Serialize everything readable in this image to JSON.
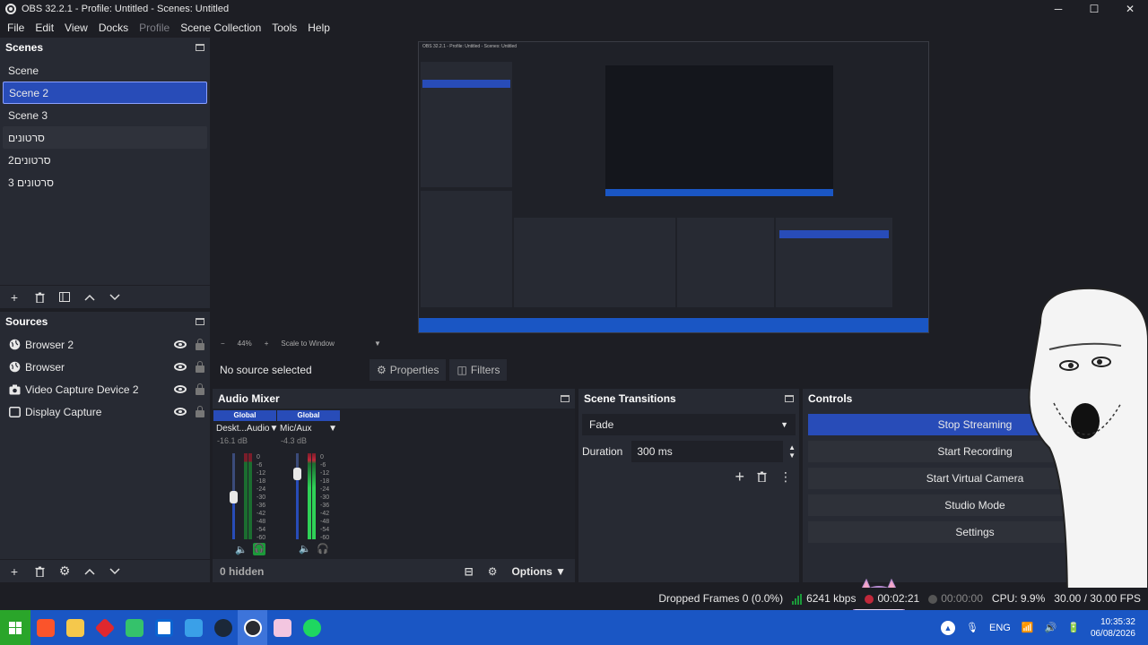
{
  "window": {
    "title": "OBS 32.2.1 - Profile: Untitled - Scenes: Untitled",
    "min": "─",
    "max": "☐",
    "close": "✕"
  },
  "menu": [
    "File",
    "Edit",
    "View",
    "Docks",
    "Profile",
    "Scene Collection",
    "Tools",
    "Help"
  ],
  "scenes": {
    "title": "Scenes",
    "items": [
      "Scene",
      "Scene 2",
      "Scene 3",
      "סרטונים",
      "סרטונים2",
      "סרטונים 3"
    ],
    "selected": "Scene 2"
  },
  "sources": {
    "title": "Sources",
    "items": [
      {
        "label": "Browser 2",
        "icon": "globe-icon"
      },
      {
        "label": "Browser",
        "icon": "globe-icon"
      },
      {
        "label": "Video Capture Device 2",
        "icon": "camera-icon"
      },
      {
        "label": "Display Capture",
        "icon": "monitor-icon"
      }
    ]
  },
  "preview_bar": {
    "zoom": "44%",
    "scale_mode": "Scale to Window"
  },
  "context": {
    "no_source": "No source selected",
    "properties": "Properties",
    "filters": "Filters"
  },
  "audio_mixer": {
    "title": "Audio Mixer",
    "channels": [
      {
        "header": "Global",
        "name": "Deskt...Audio",
        "db": "-16.1 dB",
        "volume_level": 0.5
      },
      {
        "header": "Global",
        "name": "Mic/Aux",
        "db": "-4.3 dB",
        "volume_level": 0.8
      }
    ],
    "scale": [
      "0",
      "-6",
      "-12",
      "-18",
      "-24",
      "-30",
      "-36",
      "-42",
      "-48",
      "-54",
      "-60"
    ],
    "hidden": "0 hidden",
    "options": "Options"
  },
  "transitions": {
    "title": "Scene Transitions",
    "selected": "Fade",
    "duration_label": "Duration",
    "duration_value": "300 ms"
  },
  "controls": {
    "title": "Controls",
    "buttons": [
      "Stop Streaming",
      "Start Recording",
      "Start Virtual Camera",
      "Studio Mode",
      "Settings"
    ]
  },
  "status": {
    "dropped": "Dropped Frames 0 (0.0%)",
    "bitrate": "6241 kbps",
    "stream_time": "00:02:21",
    "rec_time": "00:00:00",
    "cpu": "CPU: 9.9%",
    "fps": "30.00 / 30.00 FPS"
  },
  "taskbar": {
    "lang": "ENG",
    "time": "10:35:32",
    "date": "06/08/2026"
  },
  "colors": {
    "accent": "#284cb8",
    "dock_bg": "#272a33",
    "window_bg": "#1d1e24",
    "taskbar": "#1a56c4",
    "meter_green": "#1b9a3a"
  }
}
